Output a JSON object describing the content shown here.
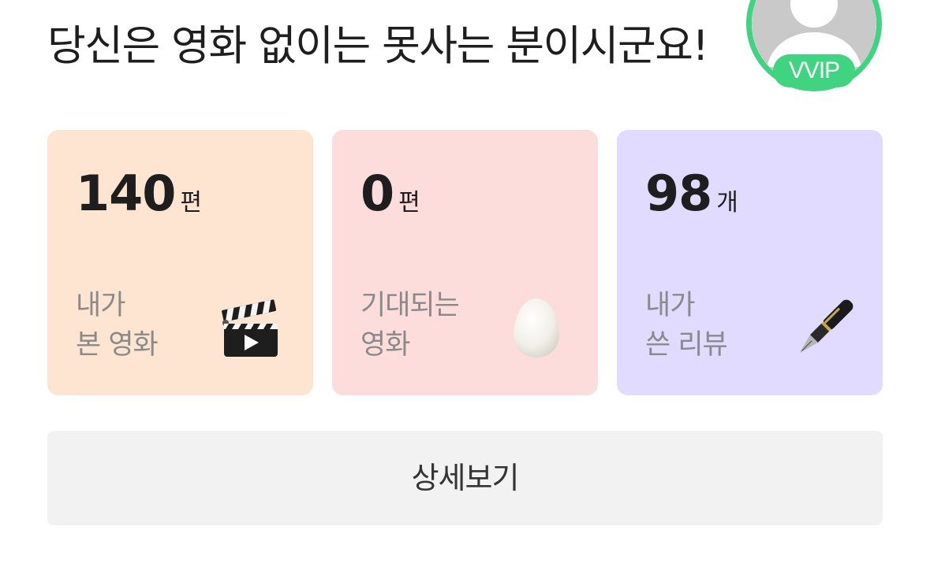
{
  "header": {
    "headline": "당신은 영화 없이는 못사는 분이시군요!",
    "badge": "VVIP",
    "avatar_icon": "default-user-icon",
    "accent_color": "#3fd47f"
  },
  "stats": [
    {
      "value": "140",
      "unit": "편",
      "label_line1": "내가",
      "label_line2": "본 영화",
      "icon": "clapperboard-icon",
      "bg_color": "#fde5d1"
    },
    {
      "value": "0",
      "unit": "편",
      "label_line1": "기대되는",
      "label_line2": "영화",
      "icon": "egg-icon",
      "bg_color": "#fddcdc"
    },
    {
      "value": "98",
      "unit": "개",
      "label_line1": "내가",
      "label_line2": "쓴 리뷰",
      "icon": "fountain-pen-icon",
      "bg_color": "#e0dbff"
    }
  ],
  "detail_button": {
    "label": "상세보기"
  }
}
